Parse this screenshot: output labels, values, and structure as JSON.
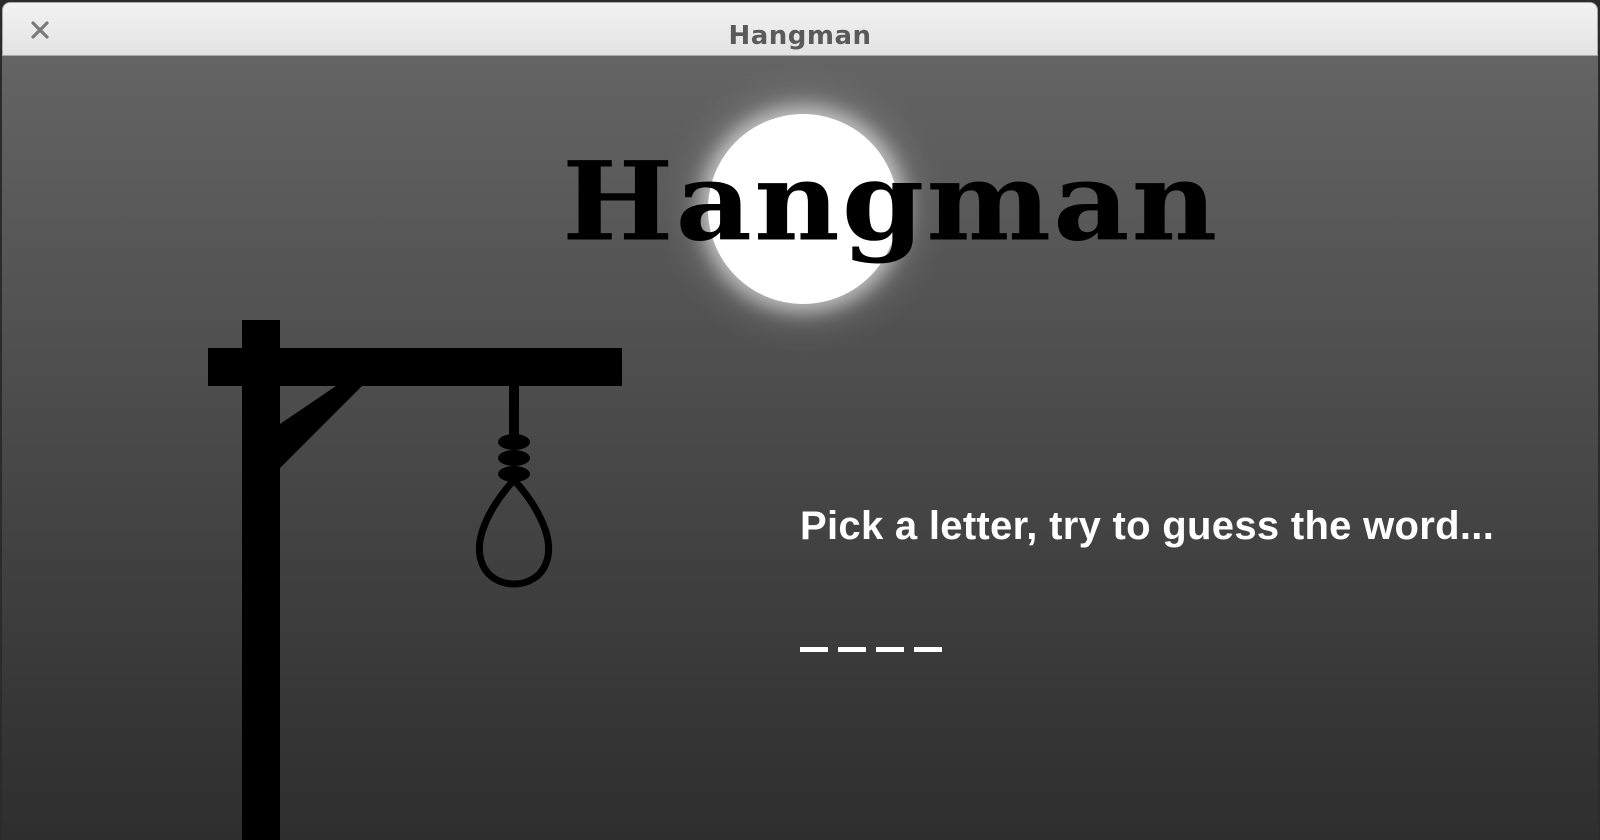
{
  "window": {
    "title": "Hangman",
    "close_icon": "close-icon"
  },
  "game": {
    "logo_text": "Hangman",
    "prompt": "Pick a letter, try to guess the word...",
    "word_slots": [
      "",
      "",
      "",
      ""
    ],
    "moon_icon": "moon-icon",
    "gallows_icon": "gallows-icon",
    "noose_icon": "noose-icon"
  },
  "colors": {
    "titlebar": "#e9e9e9",
    "background_top": "#646464",
    "background_bottom": "#2e2e2e",
    "moon": "#ffffff",
    "text": "#ffffff",
    "silhouette": "#000000"
  }
}
